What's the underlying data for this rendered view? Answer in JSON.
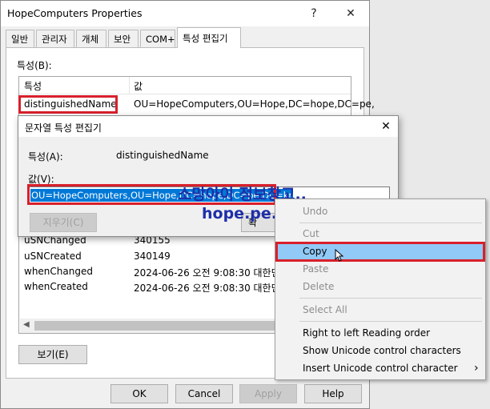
{
  "window": {
    "title": "HopeComputers Properties",
    "help": "?",
    "close": "✕"
  },
  "tabs": [
    "일반",
    "관리자",
    "개체",
    "보안",
    "COM+",
    "특성 편집기"
  ],
  "panel": {
    "attributes_label": "특성(B):",
    "columns": [
      "특성",
      "값"
    ],
    "rows": [
      {
        "name": "distinguishedName",
        "value": "OU=HopeComputers,OU=Hope,DC=hope,DC=pe,"
      },
      {
        "name": "uSNChanged",
        "value": "340155"
      },
      {
        "name": "uSNCreated",
        "value": "340149"
      },
      {
        "name": "whenChanged",
        "value": "2024-06-26 오전 9:08:30 대한민"
      },
      {
        "name": "whenCreated",
        "value": "2024-06-26 오전 9:08:30 대한민"
      }
    ],
    "view_button": "보기(E)"
  },
  "footer": {
    "ok": "OK",
    "cancel": "Cancel",
    "apply": "Apply",
    "help": "Help"
  },
  "editor": {
    "title": "문자열 특성 편집기",
    "attribute_label": "특성(A):",
    "attribute_value": "distinguishedName",
    "value_label": "값(V):",
    "value_text": "OU=HopeComputers,OU=Hope,DC=hope,DC=pe,DC=kr",
    "clear_button": "지우기(C)",
    "ok_button": "확"
  },
  "context_menu": {
    "items": [
      "Undo",
      "Cut",
      "Copy",
      "Paste",
      "Delete",
      "Select All",
      "Right to left Reading order",
      "Show Unicode control characters",
      "Insert Unicode control character"
    ],
    "submenu_arrow": "›"
  },
  "watermark": {
    "line1": "소망아이 정보창고..",
    "line2": "hope.pe.kr"
  },
  "colors": {
    "highlight": "#0078d7",
    "menu_highlight": "#91c9f7",
    "annotation": "#d8202b",
    "watermark": "#1e2fa8"
  }
}
